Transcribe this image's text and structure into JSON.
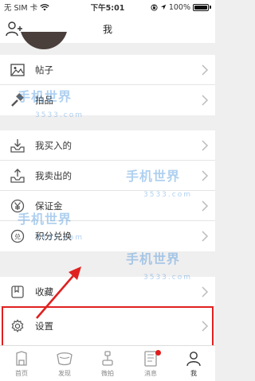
{
  "status_bar": {
    "carrier": "无 SIM 卡",
    "time": "下午5:01",
    "battery": "100%"
  },
  "header": {
    "title": "我"
  },
  "menu_group_1": [
    {
      "label": "帖子",
      "icon": "image-icon"
    },
    {
      "label": "拍品",
      "icon": "gavel-icon"
    }
  ],
  "menu_group_2": [
    {
      "label": "我买入的",
      "icon": "download-tray-icon"
    },
    {
      "label": "我卖出的",
      "icon": "upload-tray-icon"
    },
    {
      "label": "保证金",
      "icon": "yen-coin-icon"
    },
    {
      "label": "积分兑换",
      "icon": "points-badge-icon"
    }
  ],
  "menu_group_3": [
    {
      "label": "收藏",
      "icon": "favorites-icon"
    },
    {
      "label": "设置",
      "icon": "gear-icon"
    }
  ],
  "tab_bar": [
    {
      "label": "首页",
      "icon": "home-icon"
    },
    {
      "label": "发现",
      "icon": "discover-icon"
    },
    {
      "label": "微拍",
      "icon": "auction-icon"
    },
    {
      "label": "消息",
      "icon": "message-icon",
      "has_notification": true
    },
    {
      "label": "我",
      "icon": "profile-icon",
      "active": true
    }
  ],
  "watermark": {
    "text": "手机世界",
    "sub": "3533.com"
  },
  "colors": {
    "highlight": "#e02020",
    "notification": "#e01b1b",
    "watermark": "#1e7cd6",
    "background": "#f0efef"
  }
}
